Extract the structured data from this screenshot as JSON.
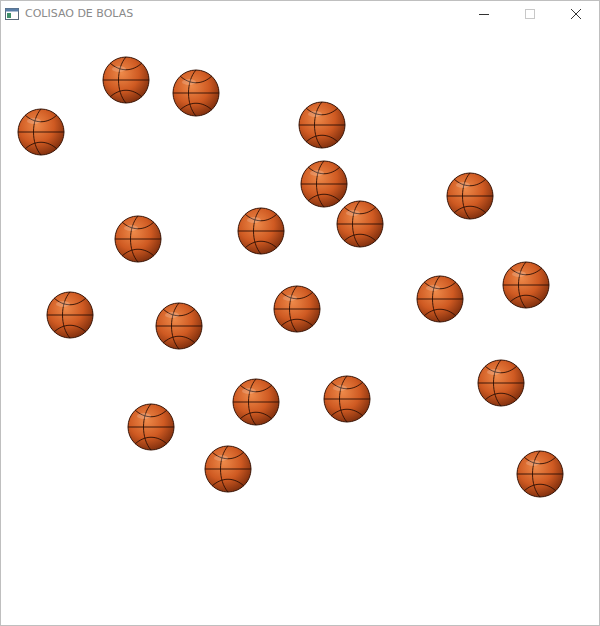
{
  "window": {
    "title": "COLISAO DE BOLAS",
    "controls": [
      {
        "kind": "minimize",
        "disabled": false
      },
      {
        "kind": "maximize",
        "disabled": true
      },
      {
        "kind": "close",
        "disabled": false
      }
    ]
  }
}
